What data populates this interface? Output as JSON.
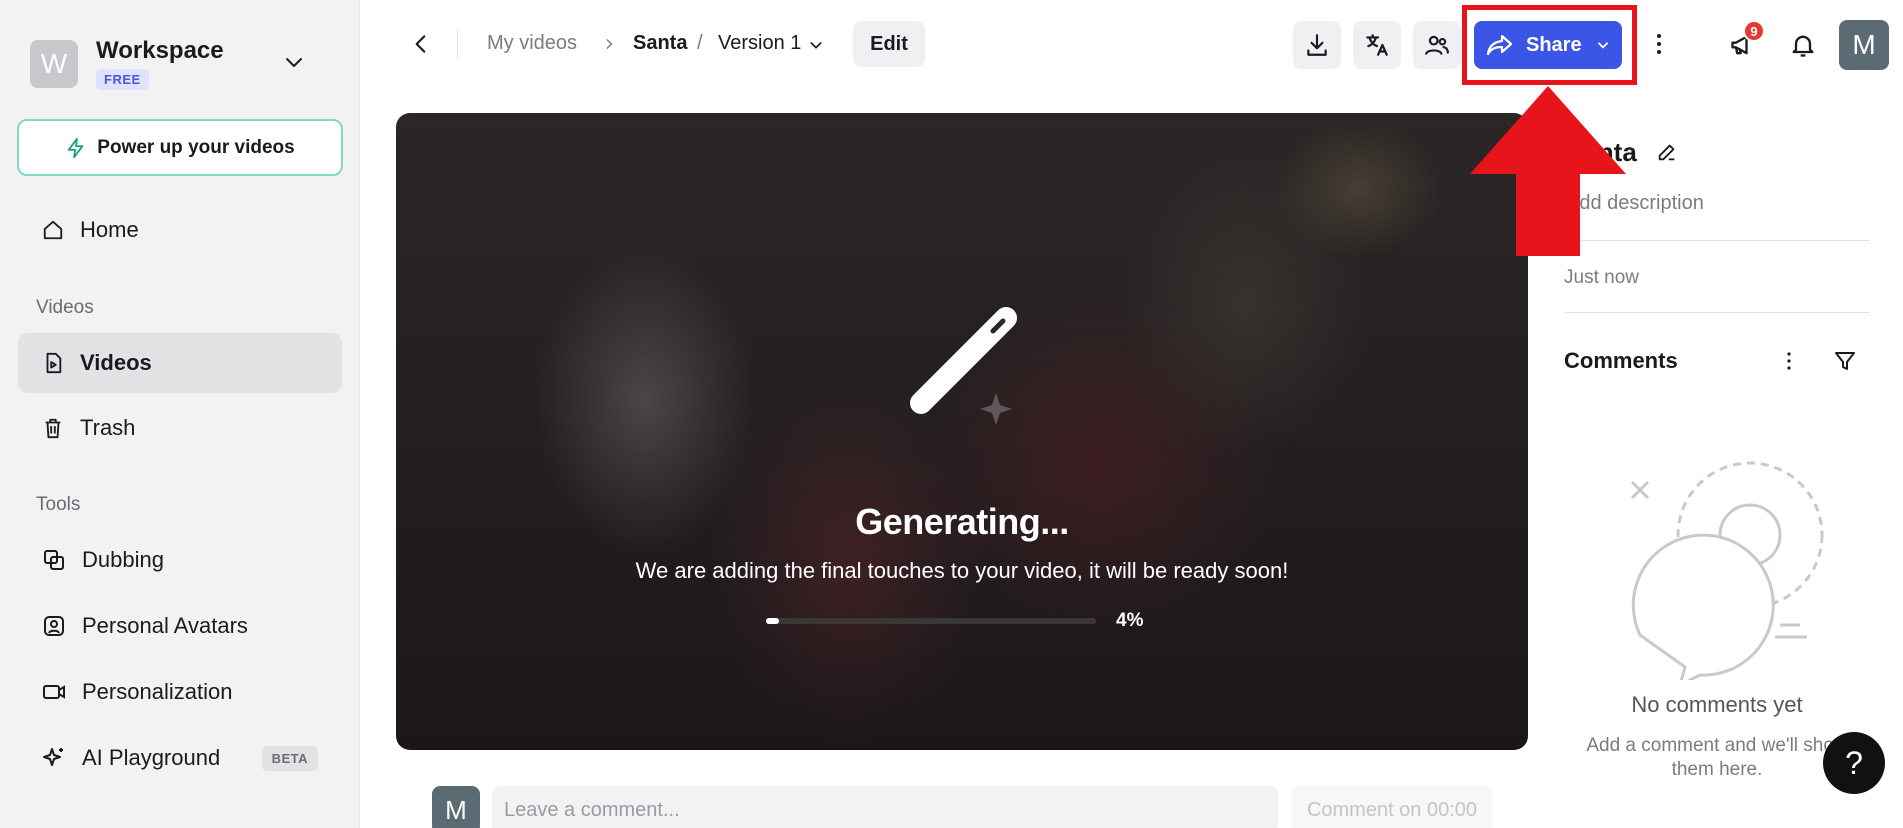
{
  "workspace": {
    "initial": "W",
    "name": "Workspace",
    "plan": "FREE"
  },
  "sidebar": {
    "power_up": "Power up your videos",
    "home": "Home",
    "videos_section": "Videos",
    "videos": "Videos",
    "trash": "Trash",
    "tools_section": "Tools",
    "dubbing": "Dubbing",
    "personal_avatars": "Personal Avatars",
    "personalization": "Personalization",
    "ai_playground": "AI Playground",
    "beta": "BETA"
  },
  "breadcrumb": {
    "root": "My videos",
    "separator": ">",
    "project": "Santa",
    "slash": "/",
    "version": "Version 1"
  },
  "toolbar": {
    "edit": "Edit",
    "share": "Share",
    "notifications_count": "9",
    "user_initial": "M"
  },
  "video": {
    "status_title": "Generating...",
    "status_message": "We are adding the final touches to your video, it will be ready soon!",
    "progress_percent": 4,
    "progress_label": "4%"
  },
  "comment_bar": {
    "avatar_initial": "M",
    "placeholder": "Leave a comment...",
    "submit": "Comment on 00:00"
  },
  "details": {
    "title": "Santa",
    "description_placeholder": "Add description",
    "timestamp": "Just now"
  },
  "comments": {
    "heading": "Comments",
    "empty_title": "No comments yet",
    "empty_message": "Add a comment and we'll show them here."
  },
  "help": "?",
  "colors": {
    "accent": "#3b56e6",
    "annotation": "#e8141c",
    "badge": "#e53935"
  }
}
